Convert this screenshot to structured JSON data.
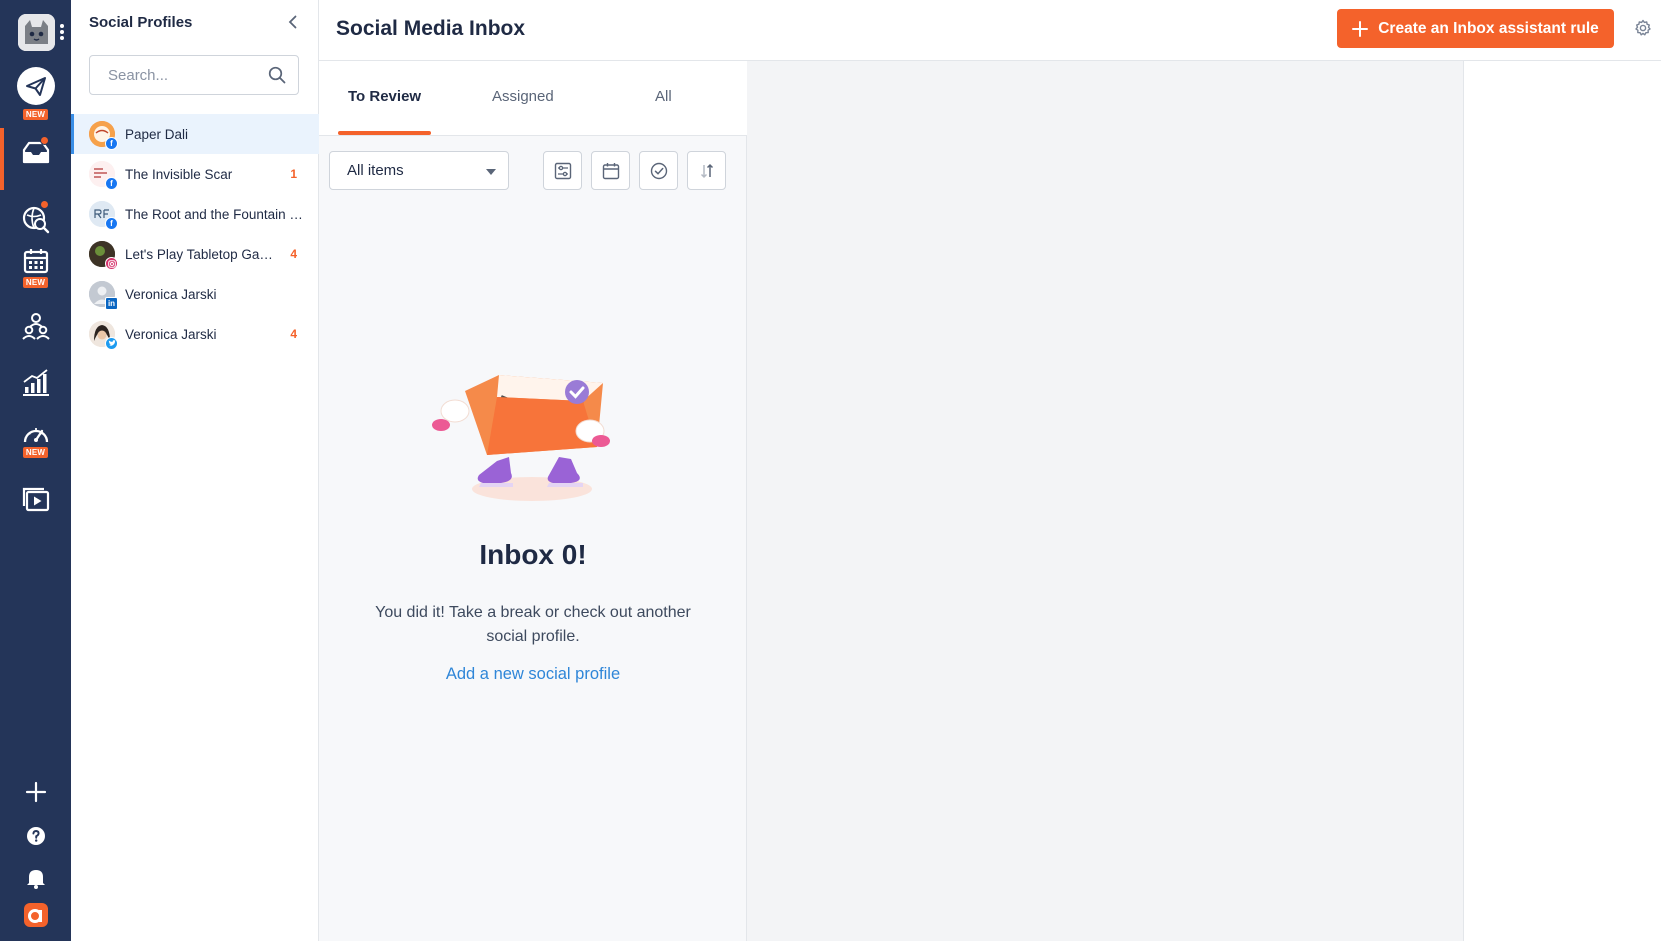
{
  "brand": {
    "accent": "#f4622b",
    "rail_bg": "#243559",
    "link": "#2f86d8"
  },
  "nav": {
    "new_badge": "NEW",
    "items": [
      {
        "icon": "compose-send-icon",
        "badge": "NEW"
      },
      {
        "icon": "inbox-icon",
        "active": true
      },
      {
        "icon": "listening-search-icon"
      },
      {
        "icon": "calendar-icon",
        "badge": "NEW"
      },
      {
        "icon": "team-icon"
      },
      {
        "icon": "analytics-icon"
      },
      {
        "icon": "dashboard-gauge-icon",
        "badge": "NEW"
      },
      {
        "icon": "media-library-icon"
      }
    ],
    "bottom": [
      "add-icon",
      "help-icon",
      "bell-icon",
      "app-logo-icon"
    ]
  },
  "profiles": {
    "title": "Social Profiles",
    "search_placeholder": "Search...",
    "items": [
      {
        "name": "Paper Dali",
        "network": "facebook",
        "count": ""
      },
      {
        "name": "The Invisible Scar",
        "network": "facebook",
        "count": "1"
      },
      {
        "name": "The Root and the Fountain …",
        "network": "facebook",
        "count": ""
      },
      {
        "name": "Let's Play Tabletop Ga…",
        "network": "instagram",
        "count": "4"
      },
      {
        "name": "Veronica Jarski",
        "network": "linkedin",
        "count": ""
      },
      {
        "name": "Veronica Jarski",
        "network": "twitter",
        "count": "4"
      }
    ]
  },
  "header": {
    "title": "Social Media Inbox",
    "cta_label": "Create an Inbox assistant rule"
  },
  "inbox": {
    "tabs": [
      "To Review",
      "Assigned",
      "All"
    ],
    "active_tab": "To Review",
    "filter_selected": "All items",
    "toolbar_icons": [
      "filter-settings-icon",
      "calendar-icon",
      "check-circle-icon",
      "sort-icon"
    ],
    "empty": {
      "title": "Inbox 0!",
      "text": "You did it! Take a break or check out another social profile.",
      "link": "Add a new social profile"
    }
  }
}
